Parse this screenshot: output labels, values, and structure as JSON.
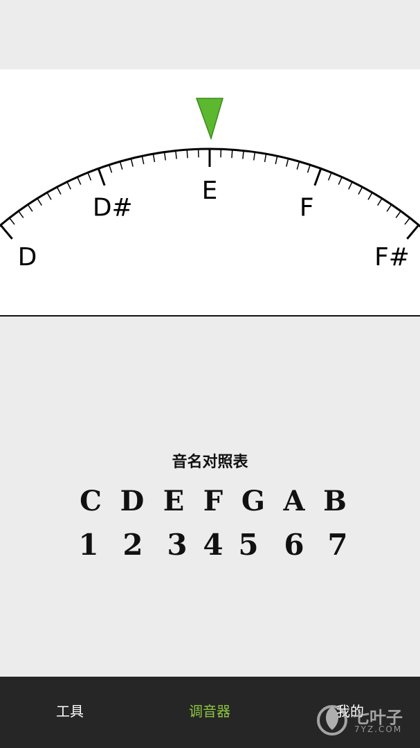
{
  "tuner": {
    "note_labels": [
      "D",
      "D#",
      "E",
      "F",
      "F#"
    ],
    "active_note": "E",
    "indicator_color": "#5cb82e"
  },
  "chart": {
    "title": "音名对照表",
    "letters": [
      "C",
      "D",
      "E",
      "F",
      "G",
      "A",
      "B"
    ],
    "numbers": [
      "1",
      "2",
      "3",
      "4",
      "5",
      "6",
      "7"
    ]
  },
  "nav": {
    "tools": "工具",
    "tuner": "调音器",
    "mine": "我的",
    "active_color": "#8cc63f"
  },
  "watermark": {
    "text": "七叶子",
    "sub": "7YZ.COM"
  }
}
